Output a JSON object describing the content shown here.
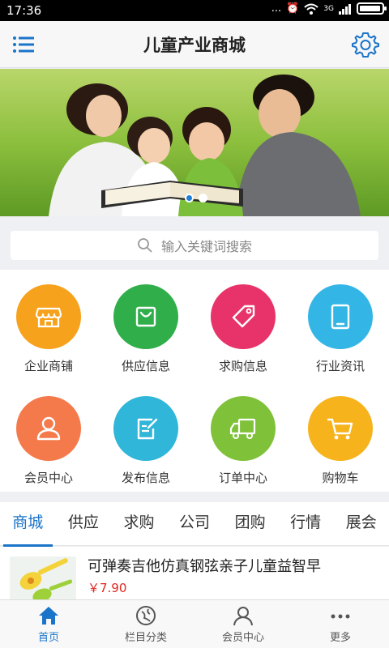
{
  "status_bar": {
    "time": "17:36",
    "dots": "...",
    "signal_label": "3G"
  },
  "header": {
    "title": "儿童产业商城"
  },
  "search": {
    "placeholder": "输入关键词搜索"
  },
  "grid_items": [
    {
      "label": "企业商铺",
      "icon": "shop-icon",
      "color": "#f7a21c"
    },
    {
      "label": "供应信息",
      "icon": "bag-icon",
      "color": "#2fae4a"
    },
    {
      "label": "求购信息",
      "icon": "tag-icon",
      "color": "#e8336a"
    },
    {
      "label": "行业资讯",
      "icon": "tablet-icon",
      "color": "#33b6e6"
    },
    {
      "label": "会员中心",
      "icon": "user-icon",
      "color": "#f47a4b"
    },
    {
      "label": "发布信息",
      "icon": "edit-icon",
      "color": "#2fb6d8"
    },
    {
      "label": "订单中心",
      "icon": "truck-icon",
      "color": "#7fc23a"
    },
    {
      "label": "购物车",
      "icon": "cart-icon",
      "color": "#f6b31c"
    }
  ],
  "tabs": [
    "商城",
    "供应",
    "求购",
    "公司",
    "团购",
    "行情",
    "展会"
  ],
  "product": {
    "title": "可弹奏吉他仿真钢弦亲子儿童益智早",
    "price": "￥7.90"
  },
  "bottom_nav": [
    {
      "label": "首页",
      "icon": "home-icon"
    },
    {
      "label": "栏目分类",
      "icon": "compass-icon"
    },
    {
      "label": "会员中心",
      "icon": "person-icon"
    },
    {
      "label": "更多",
      "icon": "more-dots-icon"
    }
  ],
  "colors": {
    "accent": "#1a74c9",
    "price": "#e0261f"
  }
}
